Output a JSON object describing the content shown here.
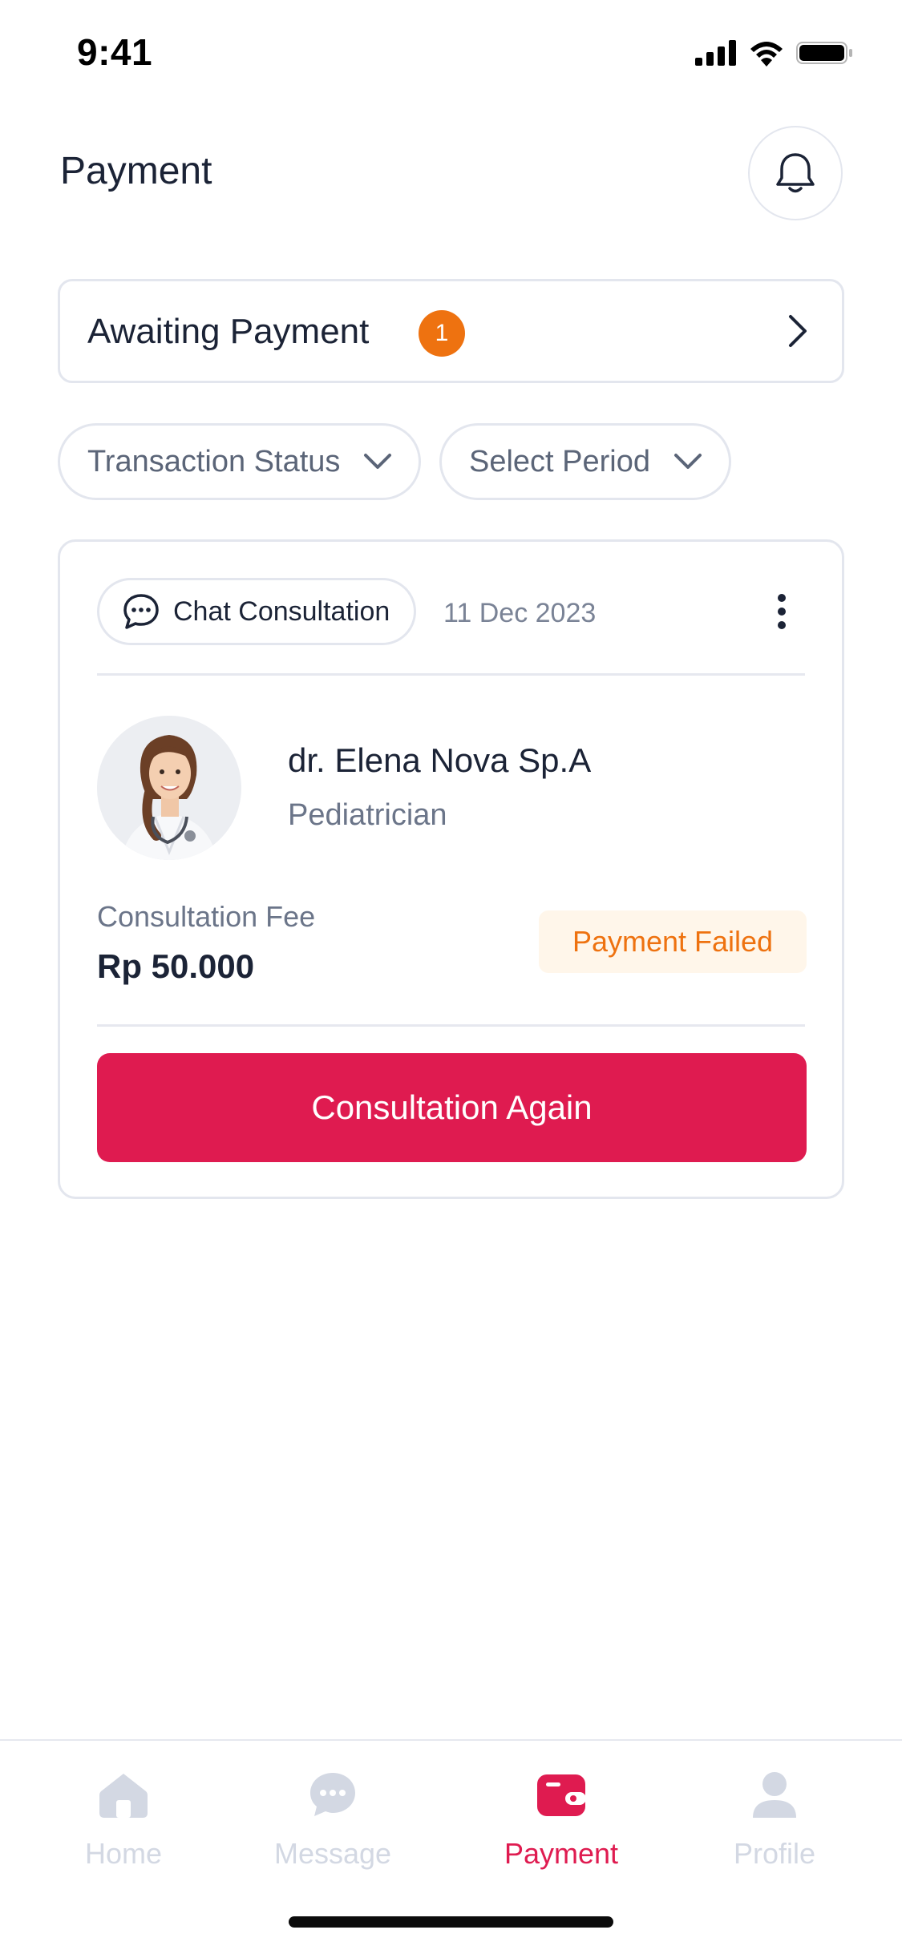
{
  "status_bar": {
    "time": "9:41"
  },
  "header": {
    "title": "Payment",
    "bell_icon": "bell-icon"
  },
  "awaiting": {
    "label": "Awaiting Payment",
    "count": "1",
    "badge_color": "#ee7210"
  },
  "filters": [
    {
      "label": "Transaction Status"
    },
    {
      "label": "Select Period"
    }
  ],
  "card": {
    "type_label": "Chat Consultation",
    "date": "11 Dec 2023",
    "doctor_name": "dr. Elena Nova Sp.A",
    "specialty": "Pediatrician",
    "fee_label": "Consultation Fee",
    "fee_value": "Rp 50.000",
    "status": "Payment Failed",
    "status_color": "#ee7210",
    "cta_label": "Consultation Again",
    "cta_color": "#df1b50"
  },
  "nav": {
    "items": [
      {
        "label": "Home",
        "icon": "home-icon",
        "active": false
      },
      {
        "label": "Message",
        "icon": "message-icon",
        "active": false
      },
      {
        "label": "Payment",
        "icon": "wallet-icon",
        "active": true
      },
      {
        "label": "Profile",
        "icon": "profile-icon",
        "active": false
      }
    ]
  }
}
